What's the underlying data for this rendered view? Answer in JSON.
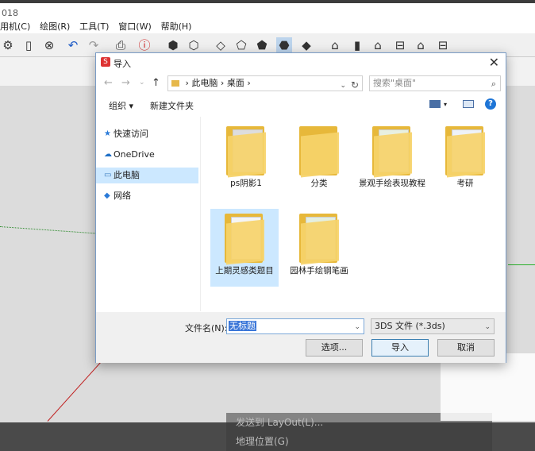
{
  "app": {
    "title_fragment": "018",
    "menu": [
      "用机(C)",
      "绘图(R)",
      "工具(T)",
      "窗口(W)",
      "帮助(H)"
    ]
  },
  "context_menu": {
    "items": [
      "发送到 LayOut(L)...",
      "地理位置(G)"
    ]
  },
  "dialog": {
    "title": "导入",
    "address": {
      "path": [
        "此电脑",
        "桌面"
      ]
    },
    "search_placeholder": "搜索\"桌面\"",
    "commands": {
      "organize": "组织 ▾",
      "new_folder": "新建文件夹"
    },
    "nav": [
      {
        "label": "快速访问",
        "icon": "star-icon"
      },
      {
        "label": "OneDrive",
        "icon": "cloud-icon"
      },
      {
        "label": "此电脑",
        "icon": "computer-icon"
      },
      {
        "label": "网络",
        "icon": "network-icon"
      }
    ],
    "selected_nav": "此电脑",
    "files": [
      {
        "label": "ps阴影1"
      },
      {
        "label": "分类"
      },
      {
        "label": "景观手绘表现教程"
      },
      {
        "label": "考研"
      },
      {
        "label": "上期灵感类题目"
      },
      {
        "label": "园林手绘钢笔画"
      }
    ],
    "filename_label": "文件名(N):",
    "filename_value": "无标题",
    "filetype_value": "3DS 文件 (*.3ds)",
    "buttons": {
      "options": "选项...",
      "import": "导入",
      "cancel": "取消"
    }
  }
}
